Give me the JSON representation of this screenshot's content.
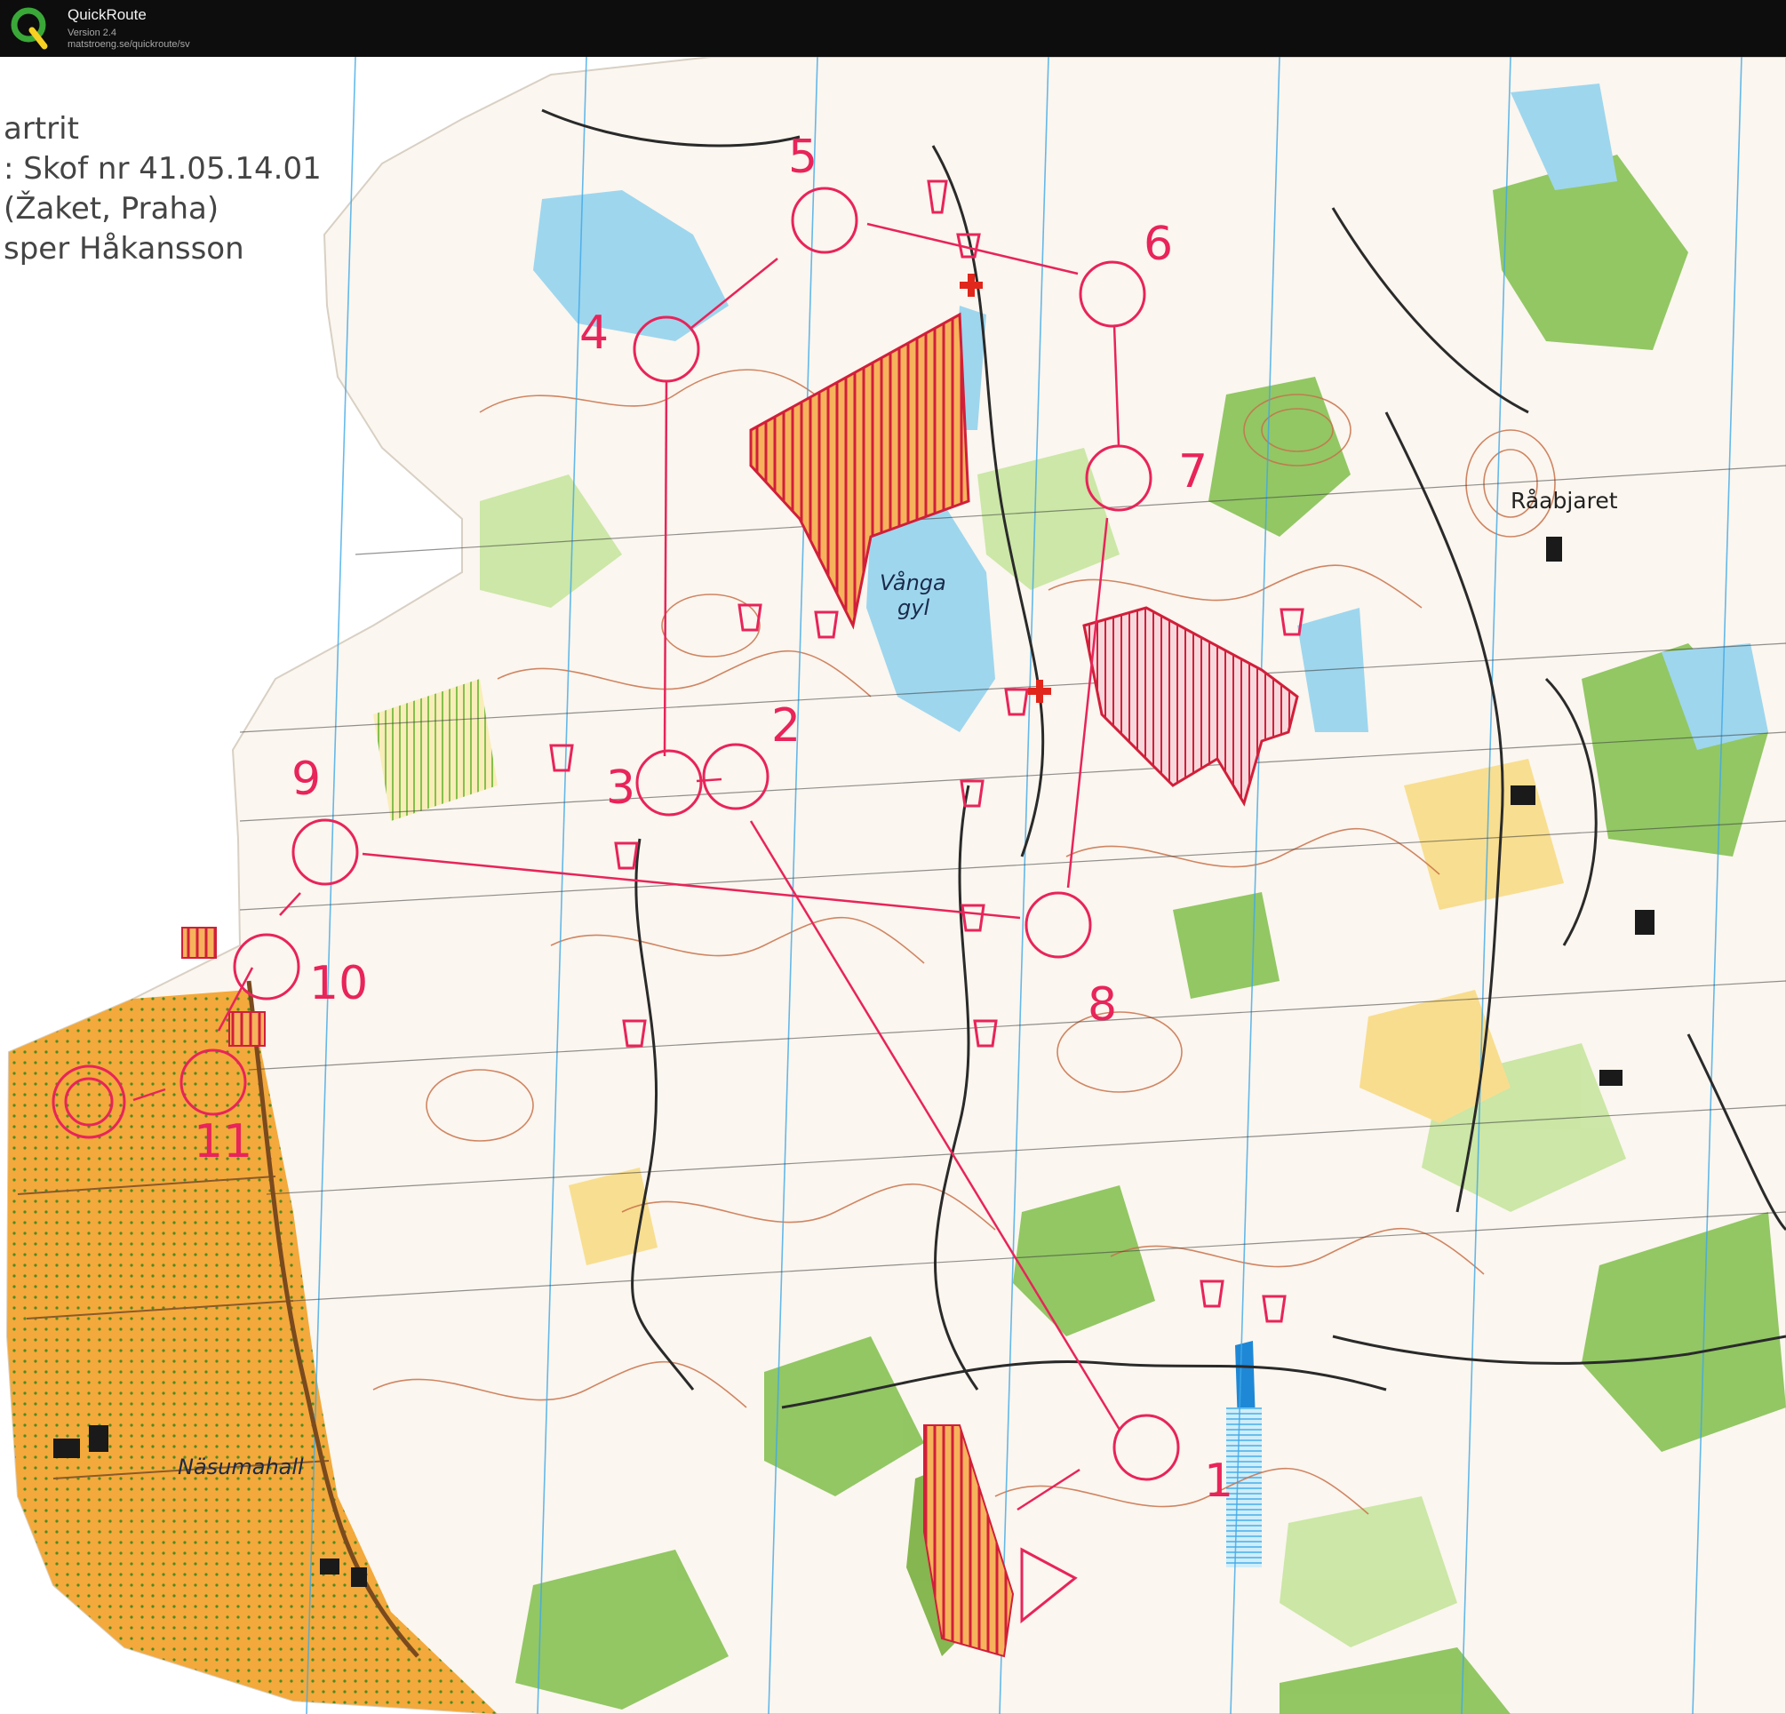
{
  "app": {
    "title": "QuickRoute",
    "version": "Version 2.4",
    "url": "matstroeng.se/quickroute/sv"
  },
  "map_info": {
    "line1": "artrit",
    "line2": ": Skof nr 41.05.14.01",
    "line3": "(Žaket, Praha)",
    "line4": "sper Håkansson"
  },
  "controls": [
    {
      "label": "1"
    },
    {
      "label": "2"
    },
    {
      "label": "3"
    },
    {
      "label": "4"
    },
    {
      "label": "5"
    },
    {
      "label": "6"
    },
    {
      "label": "7"
    },
    {
      "label": "8"
    },
    {
      "label": "9"
    },
    {
      "label": "10"
    },
    {
      "label": "11"
    }
  ],
  "place_names": {
    "vanga_1": "Vånga",
    "vanga_2": "gyl",
    "raabjaret": "Råabjaret",
    "nasumahall": "Näsumahall"
  },
  "colors": {
    "course": "#e8245a",
    "forbidden": "#d11f3a",
    "open_land": "#f3a93b",
    "rough_open": "#f8dc8a",
    "green": "#8cc45c",
    "light_green": "#c9e6a2",
    "water": "#9ed6ee",
    "contour": "#c8714a",
    "track": "#2a2a2a",
    "magnetic_north": "#3fa9e8"
  }
}
